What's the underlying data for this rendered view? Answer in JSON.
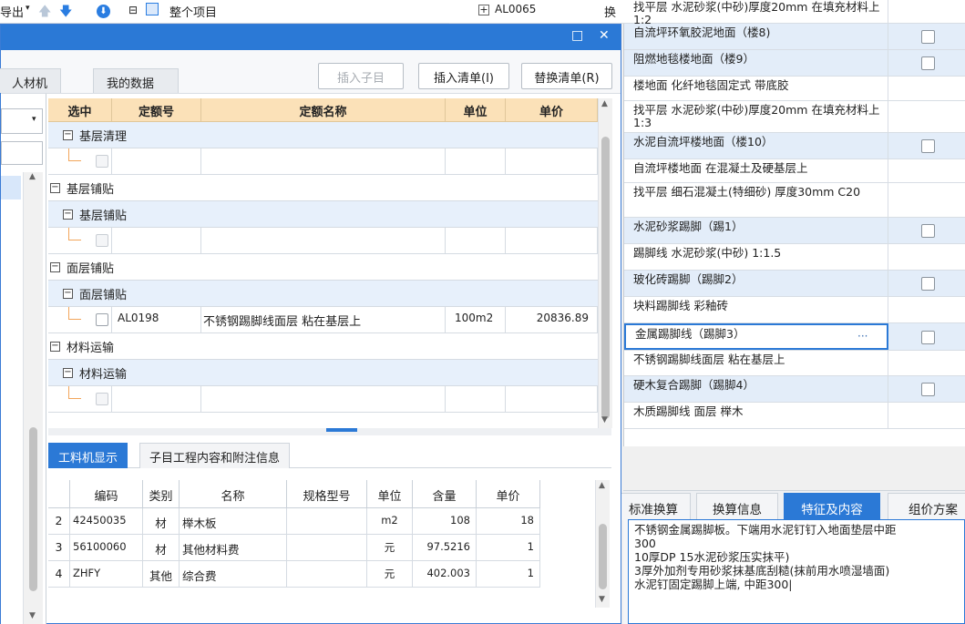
{
  "toolbar_top": {
    "export_label": "导出",
    "project_label": "整个项目"
  },
  "bg_table": {
    "top_code": "AL0065",
    "top_action": "换",
    "rows": [
      {
        "name": "找平层 水泥砂浆(中砂)厚度20mm 在填充材料上 1:2",
        "blue": false,
        "check": false
      },
      {
        "name": "自流坪环氧胶泥地面（楼8)",
        "blue": true,
        "check": true
      },
      {
        "name": "阻燃地毯楼地面（楼9）",
        "blue": true,
        "check": true
      },
      {
        "name": "楼地面 化纤地毯固定式 带底胶",
        "blue": false,
        "check": false
      },
      {
        "name": "找平层 水泥砂浆(中砂)厚度20mm 在填充材料上 1:3",
        "blue": false,
        "check": false
      },
      {
        "name": "水泥自流坪楼地面（楼10）",
        "blue": true,
        "check": true
      },
      {
        "name": "自流坪楼地面 在混凝土及硬基层上",
        "blue": false,
        "check": false
      },
      {
        "name": "找平层 细石混凝土(特细砂) 厚度30mm C20",
        "blue": false,
        "check": false
      },
      {
        "name": "水泥砂浆踢脚（踢1）",
        "blue": true,
        "check": true
      },
      {
        "name": "踢脚线 水泥砂浆(中砂) 1:1.5",
        "blue": false,
        "check": false
      },
      {
        "name": "玻化砖踢脚（踢脚2）",
        "blue": true,
        "check": true
      },
      {
        "name": "块料踢脚线 彩釉砖",
        "blue": false,
        "check": false
      },
      {
        "name": "金属踢脚线（踢脚3）",
        "blue": true,
        "check": true,
        "selected": true
      },
      {
        "name": "不锈钢踢脚线面层 粘在基层上",
        "blue": false,
        "check": false
      },
      {
        "name": "硬木复合踢脚（踢脚4）",
        "blue": true,
        "check": true
      },
      {
        "name": "木质踢脚线 面层 榉木",
        "blue": false,
        "check": false
      }
    ],
    "ellipsis": "···"
  },
  "dialog": {
    "title_icons": {
      "maximize": "□",
      "close": "✕"
    },
    "tabs": [
      "人材机",
      "我的数据"
    ],
    "buttons": {
      "insert_sub": "插入子目",
      "insert_list": "插入清单(I)",
      "replace_list": "替换清单(R)"
    },
    "grid": {
      "headers": [
        "选中",
        "定额号",
        "定额名称",
        "单位",
        "单价"
      ],
      "rows": [
        {
          "type": "group",
          "indent": 1,
          "label": "基层清理",
          "blue": true
        },
        {
          "type": "empty",
          "indent": 1
        },
        {
          "type": "group",
          "indent": 0,
          "label": "基层铺贴",
          "blue": false
        },
        {
          "type": "group",
          "indent": 1,
          "label": "基层铺贴",
          "blue": true
        },
        {
          "type": "empty",
          "indent": 1
        },
        {
          "type": "group",
          "indent": 0,
          "label": "面层铺贴",
          "blue": false
        },
        {
          "type": "group",
          "indent": 1,
          "label": "面层铺贴",
          "blue": true
        },
        {
          "type": "item",
          "indent": 1,
          "code": "AL0198",
          "name": "不锈钢踢脚线面层 粘在基层上",
          "unit": "100m2",
          "price": "20836.89"
        },
        {
          "type": "group",
          "indent": 0,
          "label": "材料运输",
          "blue": false
        },
        {
          "type": "group",
          "indent": 1,
          "label": "材料运输",
          "blue": true
        },
        {
          "type": "empty",
          "indent": 1
        }
      ]
    },
    "bottom_tabs": [
      "工料机显示",
      "子目工程内容和附注信息"
    ],
    "bottom_grid": {
      "headers": [
        "编码",
        "类别",
        "名称",
        "规格型号",
        "单位",
        "含量",
        "单价"
      ],
      "rows": [
        {
          "no": "2",
          "code": "42450035",
          "cat": "材",
          "name": "榉木板",
          "spec": "",
          "unit": "m2",
          "qty": "108",
          "price": "18"
        },
        {
          "no": "3",
          "code": "56100060",
          "cat": "材",
          "name": "其他材料费",
          "spec": "",
          "unit": "元",
          "qty": "97.5216",
          "price": "1"
        },
        {
          "no": "4",
          "code": "ZHFY",
          "cat": "其他",
          "name": "综合费",
          "spec": "",
          "unit": "元",
          "qty": "402.003",
          "price": "1"
        }
      ]
    }
  },
  "right_lower": {
    "tabs": [
      "标准换算",
      "换算信息",
      "特征及内容",
      "组价方案"
    ],
    "text_lines": [
      "不锈钢金属踢脚板。下端用水泥钉钉入地面垫层中距",
      "300",
      "10厚DP 15水泥砂浆压实抹平)",
      "3厚外加剂专用砂浆抹基底刮糙(抹前用水喷湿墙面)",
      "水泥钉固定踢脚上端, 中距300|"
    ]
  }
}
